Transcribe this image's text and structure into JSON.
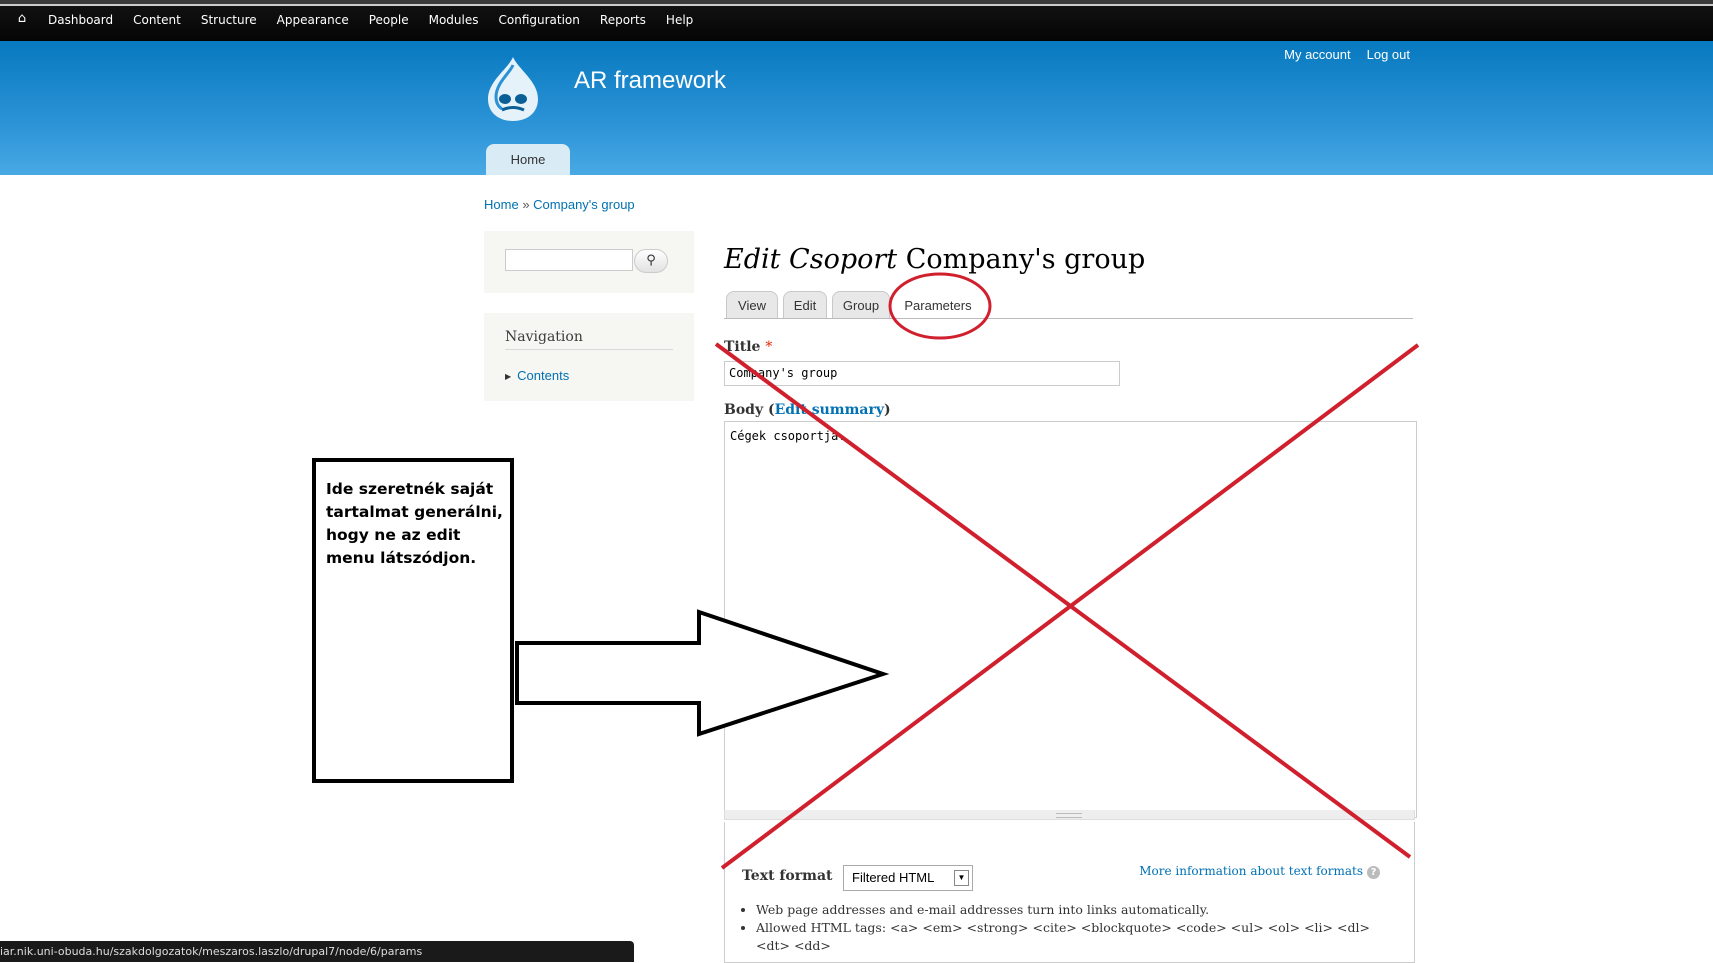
{
  "toolbar": {
    "home_icon": "home-icon",
    "items": [
      "Dashboard",
      "Content",
      "Structure",
      "Appearance",
      "People",
      "Modules",
      "Configuration",
      "Reports",
      "Help"
    ]
  },
  "header": {
    "site_name": "AR framework",
    "secondary_menu": [
      "My account",
      "Log out"
    ],
    "main_menu": [
      "Home"
    ]
  },
  "breadcrumb": {
    "items": [
      "Home",
      "Company's group"
    ],
    "separator": "»"
  },
  "sidebar": {
    "search_value": "",
    "search_icon": "magnifier-icon",
    "navigation_title": "Navigation",
    "navigation_items": [
      "Contents"
    ]
  },
  "page": {
    "title_prefix": "Edit Csoport",
    "title_name": "Company's group",
    "tabs": [
      "View",
      "Edit",
      "Group",
      "Parameters"
    ],
    "title_label": "Title",
    "required_mark": "*",
    "title_value": "Company's group",
    "body_label": "Body (",
    "edit_summary_link": "Edit summary",
    "body_label_end": ")",
    "body_value": "Cégek csoportja.",
    "text_format_label": "Text format",
    "text_format_value": "Filtered HTML",
    "more_info_link": "More information about text formats",
    "tips": [
      "Web page addresses and e-mail addresses turn into links automatically.",
      "Allowed HTML tags: <a> <em> <strong> <cite> <blockquote> <code> <ul> <ol> <li> <dl> <dt> <dd>"
    ]
  },
  "annotation": {
    "note": "Ide szeretnék saját tartalmat generálni, hogy ne az edit menu látszódjon.",
    "stroke_color": "#d0202e"
  },
  "status_bar": {
    "url": "iar.nik.uni-obuda.hu/szakdolgozatok/meszaros.laszlo/drupal7/node/6/params"
  },
  "colors": {
    "header_blue": "#0779bf",
    "link": "#0071b3"
  }
}
